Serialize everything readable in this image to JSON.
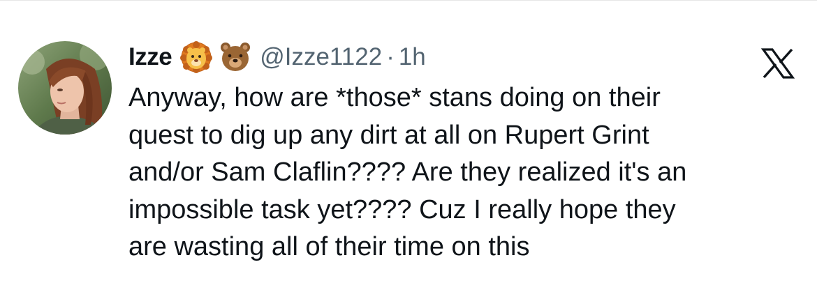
{
  "tweet": {
    "author": {
      "display_name": "Izze",
      "handle": "@Izze1122",
      "badges": [
        "lion-emoji",
        "bear-emoji"
      ]
    },
    "separator": "·",
    "time": "1h",
    "platform_icon": "x-logo-icon",
    "text_lines": [
      "Anyway, how are *those* stans doing on their",
      "quest to dig up any dirt at all on Rupert Grint",
      "and/or Sam Claflin???? Are they realized it's an",
      "impossible task yet???? Cuz I really hope they",
      "are wasting all of their time on this"
    ]
  },
  "colors": {
    "text_primary": "#0f1419",
    "text_secondary": "#536471",
    "background": "#ffffff"
  }
}
